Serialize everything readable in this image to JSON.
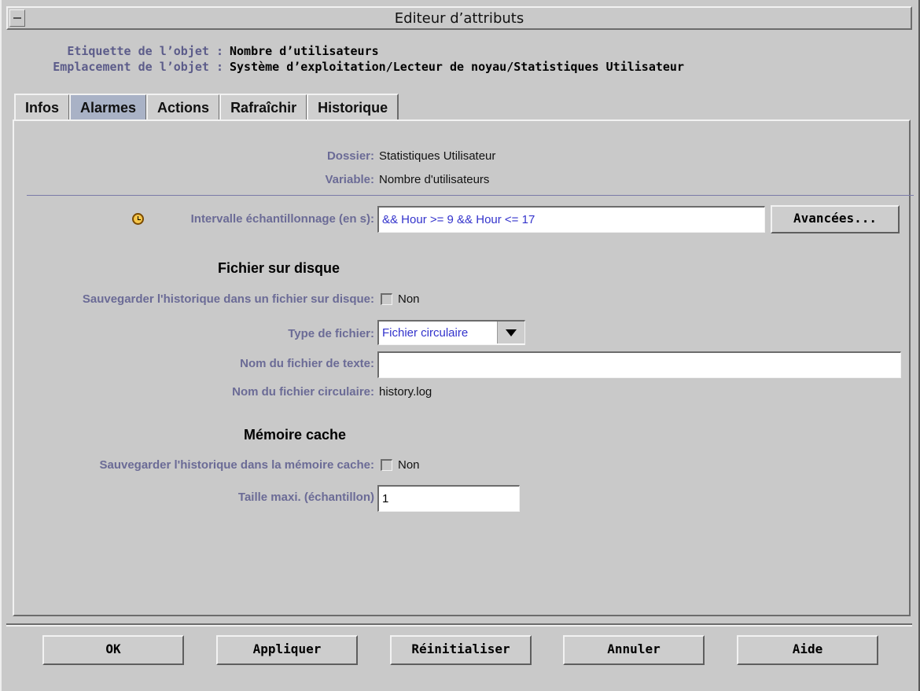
{
  "window": {
    "title": "Editeur d’attributs"
  },
  "object": {
    "label_key": "Etiquette de l’objet :",
    "label_value": "Nombre d’utilisateurs",
    "location_key": "Emplacement de l’objet :",
    "location_value": "Système d’exploitation/Lecteur de noyau/Statistiques Utilisateur"
  },
  "tabs": [
    {
      "label": "Infos",
      "active": false
    },
    {
      "label": "Alarmes",
      "active": true
    },
    {
      "label": "Actions",
      "active": false
    },
    {
      "label": "Rafraîchir",
      "active": false
    },
    {
      "label": "Historique",
      "active": false
    }
  ],
  "details": {
    "folder_label": "Dossier:",
    "folder_value": "Statistiques Utilisateur",
    "variable_label": "Variable:",
    "variable_value": "Nombre d'utilisateurs"
  },
  "sampling": {
    "label": "Intervalle échantillonnage (en s):",
    "value": "&& Hour >= 9 && Hour <= 17",
    "icon": "clock-icon",
    "advanced_label": "Avancées..."
  },
  "disk": {
    "heading": "Fichier sur disque",
    "save_label": "Sauvegarder l'historique dans un fichier sur disque:",
    "save_value": "Non",
    "type_label": "Type de fichier:",
    "type_value": "Fichier circulaire",
    "textfile_label": "Nom du fichier de texte:",
    "textfile_value": "",
    "circfile_label": "Nom du fichier circulaire:",
    "circfile_value": "history.log"
  },
  "cache": {
    "heading": "Mémoire cache",
    "save_label": "Sauvegarder l'historique dans la mémoire cache:",
    "save_value": "Non",
    "max_label": "Taille maxi. (échantillon)",
    "max_value": "1"
  },
  "buttons": {
    "ok": "OK",
    "apply": "Appliquer",
    "reset": "Réinitialiser",
    "cancel": "Annuler",
    "help": "Aide"
  },
  "colors": {
    "label": "#6b6b96",
    "active_tab": "#a9b2c6",
    "input_text": "#3333cc"
  }
}
